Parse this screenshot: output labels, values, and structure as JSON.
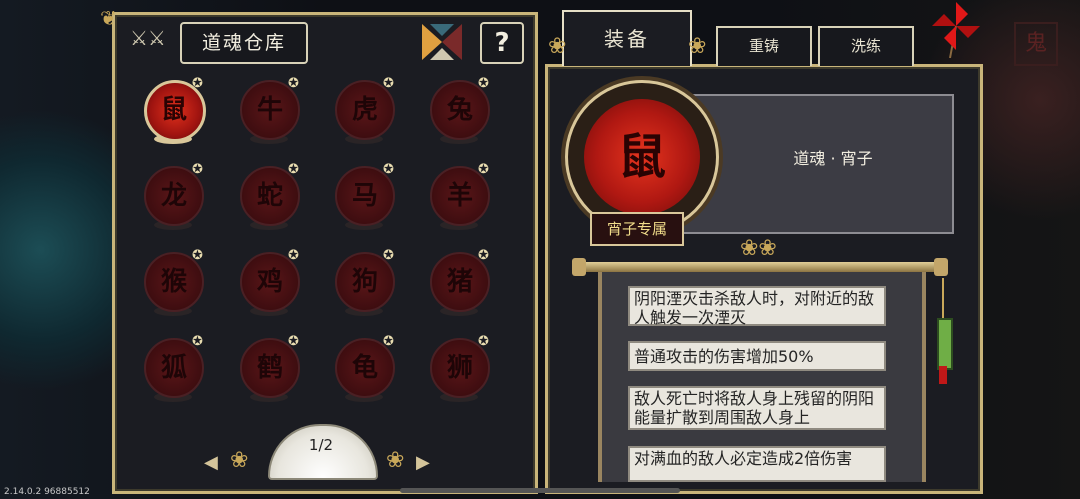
{
  "warehouse": {
    "title": "道魂仓库",
    "help_label": "?",
    "page": "1/2"
  },
  "tabs": {
    "equip": "装备",
    "recast": "重铸",
    "refine": "洗练"
  },
  "souls": [
    {
      "glyph": "鼠",
      "selected": true
    },
    {
      "glyph": "牛",
      "selected": false
    },
    {
      "glyph": "虎",
      "selected": false
    },
    {
      "glyph": "兔",
      "selected": false
    },
    {
      "glyph": "龙",
      "selected": false
    },
    {
      "glyph": "蛇",
      "selected": false
    },
    {
      "glyph": "马",
      "selected": false
    },
    {
      "glyph": "羊",
      "selected": false
    },
    {
      "glyph": "猴",
      "selected": false
    },
    {
      "glyph": "鸡",
      "selected": false
    },
    {
      "glyph": "狗",
      "selected": false
    },
    {
      "glyph": "猪",
      "selected": false
    },
    {
      "glyph": "狐",
      "selected": false
    },
    {
      "glyph": "鹤",
      "selected": false
    },
    {
      "glyph": "龟",
      "selected": false
    },
    {
      "glyph": "狮",
      "selected": false
    }
  ],
  "detail": {
    "soul_glyph": "鼠",
    "name": "道魂 · 宵子",
    "exclusive": "宵子专属",
    "effects": [
      "阴阳湮灭击杀敌人时，对附近的敌人触发一次湮灭",
      "普通攻击的伤害增加50%",
      "敌人死亡时将敌人身上残留的阴阳能量扩散到周围敌人身上",
      "对满血的敌人必定造成2倍伤害"
    ]
  },
  "version": "2.14.0.2 96885512",
  "colors": {
    "accent": "#c9b57a",
    "selected_soul": "#e0301c",
    "panel": "#1b1c22"
  }
}
